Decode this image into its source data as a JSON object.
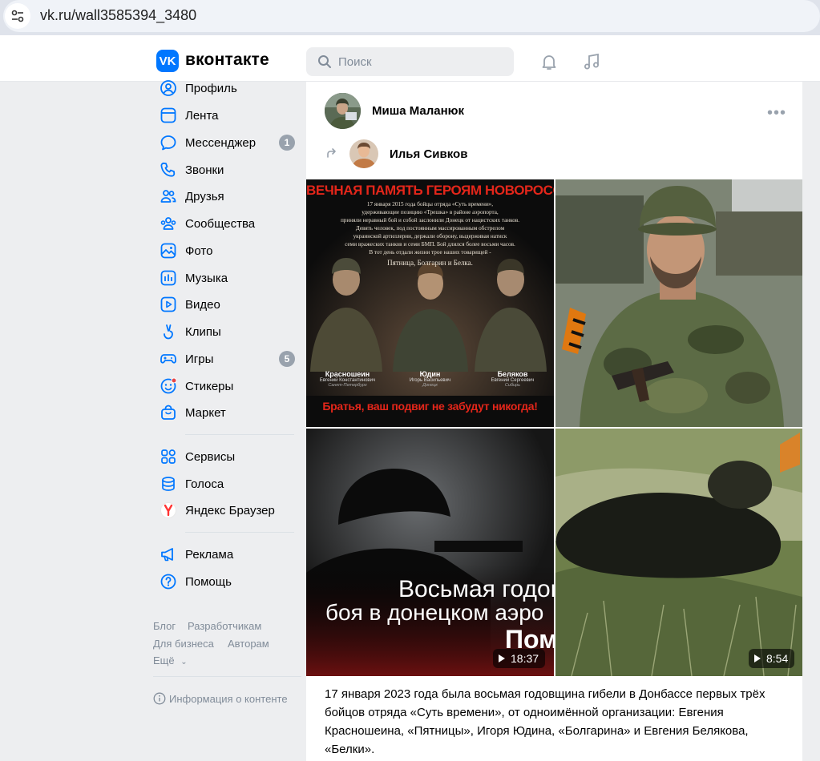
{
  "browser": {
    "url": "vk.ru/wall3585394_3480"
  },
  "header": {
    "logo_letter": "VK",
    "logo_text": "вконтакте",
    "search_placeholder": "Поиск",
    "accent": "#0077ff"
  },
  "nav": {
    "items": [
      {
        "label": "Профиль",
        "icon": "profile-icon"
      },
      {
        "label": "Лента",
        "icon": "feed-icon"
      },
      {
        "label": "Мессенджер",
        "icon": "messenger-icon",
        "badge": "1"
      },
      {
        "label": "Звонки",
        "icon": "phone-icon"
      },
      {
        "label": "Друзья",
        "icon": "friends-icon"
      },
      {
        "label": "Сообщества",
        "icon": "communities-icon"
      },
      {
        "label": "Фото",
        "icon": "photo-icon"
      },
      {
        "label": "Музыка",
        "icon": "music-icon"
      },
      {
        "label": "Видео",
        "icon": "video-icon"
      },
      {
        "label": "Клипы",
        "icon": "clips-icon"
      },
      {
        "label": "Игры",
        "icon": "games-icon",
        "badge": "5"
      },
      {
        "label": "Стикеры",
        "icon": "stickers-icon"
      },
      {
        "label": "Маркет",
        "icon": "market-icon"
      }
    ],
    "items2": [
      {
        "label": "Сервисы",
        "icon": "services-icon"
      },
      {
        "label": "Голоса",
        "icon": "votes-icon"
      },
      {
        "label": "Яндекс Браузер",
        "icon": "yandex-icon"
      }
    ],
    "items3": [
      {
        "label": "Реклама",
        "icon": "ads-icon"
      },
      {
        "label": "Помощь",
        "icon": "help-icon"
      }
    ],
    "footer": {
      "blog": "Блог",
      "developers": "Разработчикам",
      "business": "Для бизнеса",
      "authors": "Авторам",
      "more": "Ещё",
      "info": "Информация о контенте"
    }
  },
  "post": {
    "author": "Миша Маланюк",
    "repost_author": "Илья Сивков",
    "image1": {
      "banner": "ВЕЧНАЯ ПАМЯТЬ ГЕРОЯМ НОВОРОССИИ",
      "lines": [
        "17 января 2015 года бойцы отряда «Суть времени»,",
        "удерживающие позицию «Трешка» в районе аэропорта,",
        "приняли неравный бой и собой заслонили Донецк от нацистских танков.",
        "Девять человек, под постоянным массированным обстрелом",
        "украинской артиллерии, держали оборону, выдерживая натиск",
        "семи вражеских танков и семи БМП. Бой длился более восьми часов.",
        "В тот день отдали жизни трое наших товарищей -",
        "Пятница, Болгарин и Белка."
      ],
      "names": [
        {
          "surname": "Красношеин",
          "name": "Евгений Константинович",
          "city": "Санкт-Петербург"
        },
        {
          "surname": "Юдин",
          "name": "Игорь Васильевич",
          "city": "Донецк"
        },
        {
          "surname": "Беляков",
          "name": "Евгений Сергеевич",
          "city": "Сибирь"
        }
      ],
      "footer": "Братья, ваш подвиг не забудут никогда!"
    },
    "video1": {
      "overlay_line1": "Восьмая годов",
      "overlay_line2": "боя в донецком аэро",
      "overlay_line3": "Пом",
      "duration": "18:37"
    },
    "video2": {
      "duration": "8:54"
    },
    "text": "17 января 2023 года была восьмая годовщина гибели в Донбассе первых трёх бойцов отряда «Суть времени», от одноимённой организации: Евгения Красношеина, «Пятницы», Игоря Юдина, «Болгарина» и Евгения Белякова, «Белки»."
  }
}
